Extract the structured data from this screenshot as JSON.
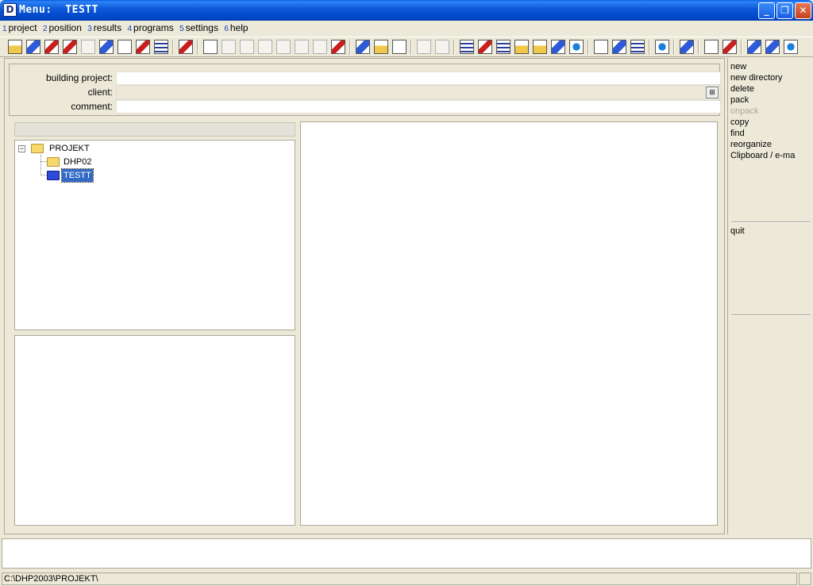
{
  "window": {
    "app_icon": "D",
    "title": "Menu:  TESTT",
    "controls": [
      "minimize-icon",
      "maximize-icon",
      "close-icon"
    ]
  },
  "menubar": [
    {
      "num": "1",
      "label": "project"
    },
    {
      "num": "2",
      "label": "position"
    },
    {
      "num": "3",
      "label": "results"
    },
    {
      "num": "4",
      "label": "programs"
    },
    {
      "num": "5",
      "label": "settings"
    },
    {
      "num": "6",
      "label": "help"
    }
  ],
  "header": {
    "building_project_label": "building project:",
    "building_project_value": "",
    "client_label": "client:",
    "client_value": "",
    "comment_label": "comment:",
    "comment_value": ""
  },
  "tree": {
    "root": "PROJEKT",
    "children": [
      "DHP02",
      "TESTT"
    ],
    "selected": "TESTT"
  },
  "side_menu": {
    "items": [
      {
        "label": "new",
        "enabled": true
      },
      {
        "label": "new directory",
        "enabled": true
      },
      {
        "label": "delete",
        "enabled": true
      },
      {
        "label": "pack",
        "enabled": true
      },
      {
        "label": "unpack",
        "enabled": false
      },
      {
        "label": "copy",
        "enabled": true
      },
      {
        "label": "find",
        "enabled": true
      },
      {
        "label": "reorganize",
        "enabled": true
      },
      {
        "label": "Clipboard / e-ma",
        "enabled": true
      }
    ],
    "quit": "quit"
  },
  "status": {
    "path": "C:\\DHP2003\\PROJEKT\\"
  }
}
